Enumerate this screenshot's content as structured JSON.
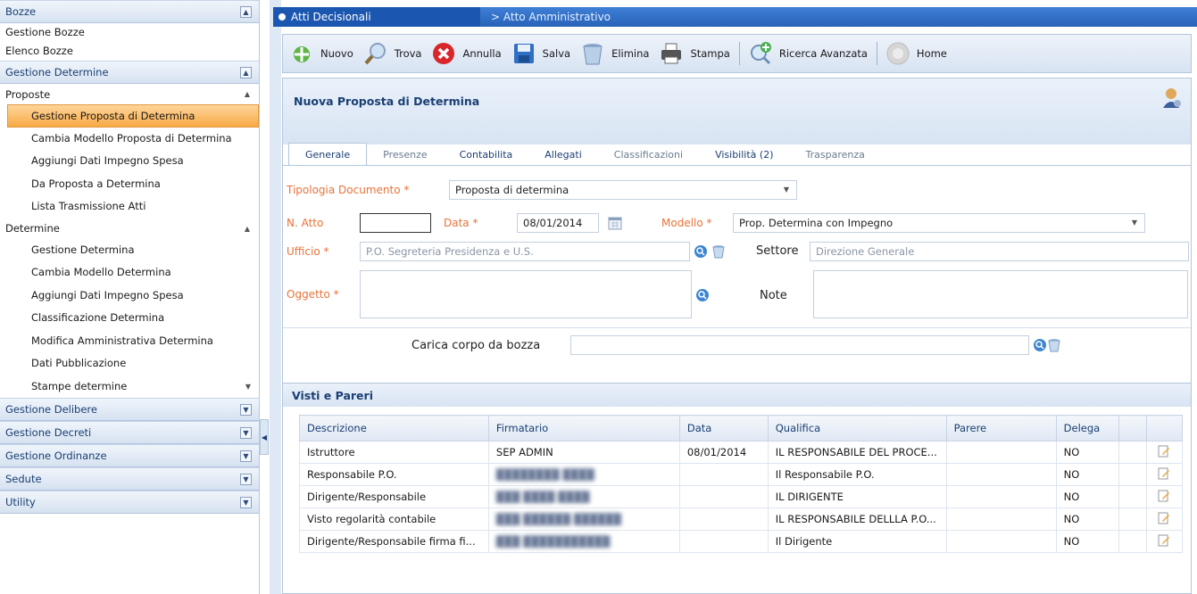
{
  "sidebar": {
    "groups": [
      {
        "label": "Bozze"
      },
      {
        "label": "Gestione Determine"
      },
      {
        "label": "Gestione Delibere"
      },
      {
        "label": "Gestione Decreti"
      },
      {
        "label": "Gestione Ordinanze"
      },
      {
        "label": "Sedute"
      },
      {
        "label": "Utility"
      }
    ],
    "bozze_items": [
      "Gestione Bozze",
      "Elenco Bozze"
    ],
    "proposte_label": "Proposte",
    "proposte_items": [
      "Gestione Proposta di Determina",
      "Cambia Modello Proposta di Determina",
      "Aggiungi Dati Impegno Spesa",
      "Da Proposta a Determina",
      "Lista Trasmissione Atti"
    ],
    "determine_label": "Determine",
    "determine_items": [
      "Gestione Determina",
      "Cambia Modello Determina",
      "Aggiungi Dati Impegno Spesa",
      "Classificazione Determina",
      "Modifica Amministrativa Determina",
      "Dati Pubblicazione",
      "Stampe determine"
    ]
  },
  "topbar": {
    "tab1": "Atti Decisionali",
    "tab2": "> Atto Amministrativo"
  },
  "toolbar": {
    "nuovo": "Nuovo",
    "trova": "Trova",
    "annulla": "Annulla",
    "salva": "Salva",
    "elimina": "Elimina",
    "stampa": "Stampa",
    "ricerca": "Ricerca Avanzata",
    "home": "Home"
  },
  "panel": {
    "title": "Nuova Proposta di Determina"
  },
  "tabs": [
    "Generale",
    "Presenze",
    "Contabilita",
    "Allegati",
    "Classificazioni",
    "Visibilità (2)",
    "Trasparenza"
  ],
  "form": {
    "tipologia_label": "Tipologia Documento *",
    "tipologia_value": "Proposta di determina",
    "natto_label": "N. Atto",
    "natto_value": "",
    "data_label": "Data *",
    "data_value": "08/01/2014",
    "modello_label": "Modello *",
    "modello_value": "Prop. Determina con Impegno",
    "ufficio_label": "Ufficio *",
    "ufficio_value": "P.O. Segreteria Presidenza e U.S.",
    "settore_label": "Settore",
    "settore_value": "Direzione Generale",
    "oggetto_label": "Oggetto *",
    "note_label": "Note",
    "carica_label": "Carica corpo da bozza"
  },
  "visti": {
    "title": "Visti e Pareri",
    "columns": [
      "Descrizione",
      "Firmatario",
      "Data",
      "Qualifica",
      "Parere",
      "Delega",
      ""
    ],
    "rows": [
      {
        "descrizione": "Istruttore",
        "firmatario": "SEP ADMIN",
        "data": "08/01/2014",
        "qualifica": "IL RESPONSABILE DEL PROCE...",
        "parere": "",
        "delega": "NO"
      },
      {
        "descrizione": "Responsabile P.O.",
        "firmatario": "████████ ████",
        "data": "",
        "qualifica": "Il Responsabile P.O.",
        "parere": "",
        "delega": "NO"
      },
      {
        "descrizione": "Dirigente/Responsabile",
        "firmatario": "███ ████ ████",
        "data": "",
        "qualifica": "IL DIRIGENTE",
        "parere": "",
        "delega": "NO"
      },
      {
        "descrizione": "Visto regolarità contabile",
        "firmatario": "███ ██████ ██████",
        "data": "",
        "qualifica": "IL RESPONSABILE DELLLA P.O...",
        "parere": "",
        "delega": "NO"
      },
      {
        "descrizione": "Dirigente/Responsabile firma fi...",
        "firmatario": "███ ███████████",
        "data": "",
        "qualifica": "Il Dirigente",
        "parere": "",
        "delega": "NO"
      }
    ]
  }
}
